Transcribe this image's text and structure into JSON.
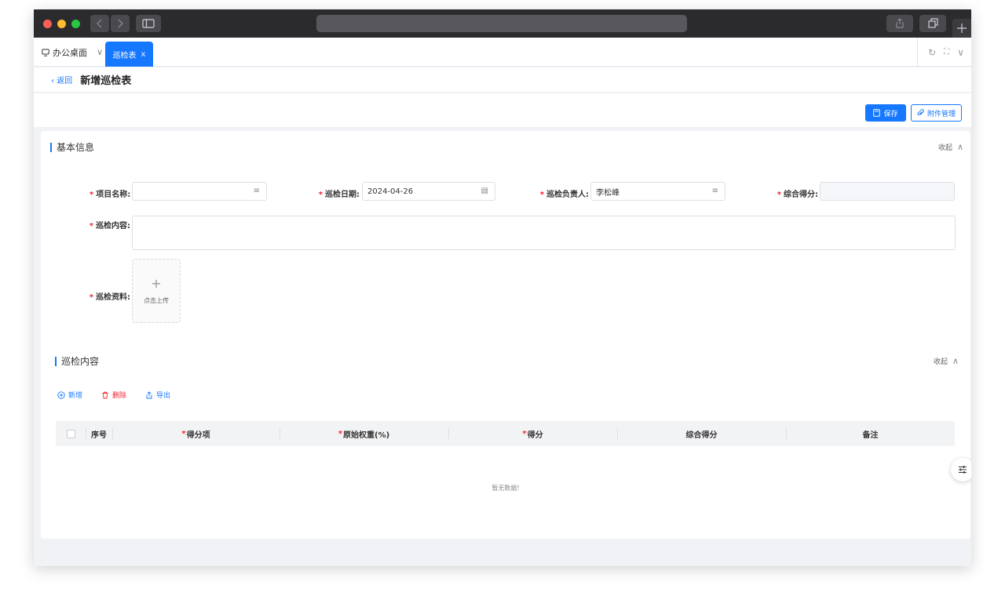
{
  "colors": {
    "accent": "#1677ff",
    "required": "#f5222d",
    "danger": "#f5222d",
    "titlebar": "#2b2b2e"
  },
  "tabs": {
    "home_label": "办公桌面",
    "active_label": "巡检表",
    "active_close": "x",
    "tool_icons": [
      "refresh-icon",
      "fullscreen-icon",
      "chevron-down-icon"
    ]
  },
  "header": {
    "back_label": "返回",
    "title": "新增巡检表"
  },
  "actions": {
    "save_label": "保存",
    "attach_label": "附件管理"
  },
  "basic_info": {
    "title": "基本信息",
    "collapse_label": "收起",
    "project_label": "项目名称:",
    "project_value": "",
    "date_label": "巡检日期:",
    "date_value": "2024-04-26",
    "owner_label": "巡检负责人:",
    "owner_value": "李松峰",
    "score_label": "综合得分:",
    "score_value": "",
    "content_label": "巡检内容:",
    "materials_label": "巡检资料:",
    "upload_label": "点击上传"
  },
  "inspection": {
    "title": "巡检内容",
    "collapse_label": "收起",
    "add_label": "新增",
    "delete_label": "删除",
    "export_label": "导出",
    "columns": [
      "序号",
      "得分项",
      "原始权重(%)",
      "得分",
      "综合得分",
      "备注"
    ],
    "empty_text": "暂无数据!"
  }
}
